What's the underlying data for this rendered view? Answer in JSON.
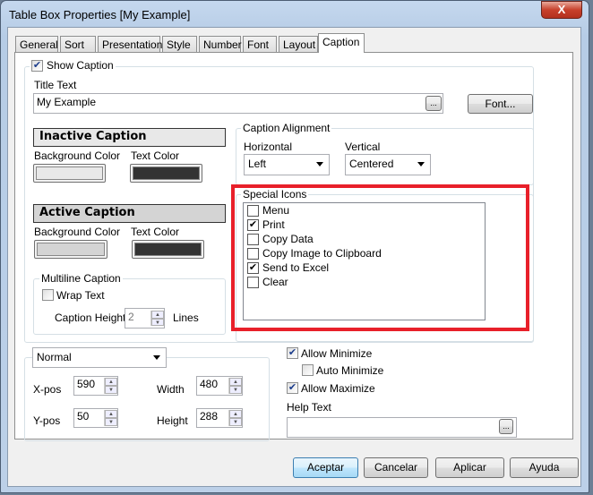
{
  "window": {
    "title": "Table Box Properties [My Example]",
    "close": "X"
  },
  "tabs": [
    "General",
    "Sort",
    "Presentation",
    "Style",
    "Number",
    "Font",
    "Layout",
    "Caption"
  ],
  "caption": {
    "show_caption": {
      "label": "Show Caption",
      "checked": true
    },
    "title_text_label": "Title Text",
    "title_text_value": "My Example",
    "ellipsis": "...",
    "font_button": "Font...",
    "inactive": {
      "header": "Inactive Caption",
      "bg_label": "Background Color",
      "text_label": "Text Color",
      "bg_color": "#e8e8e8",
      "text_color": "#333333"
    },
    "active": {
      "header": "Active Caption",
      "bg_label": "Background Color",
      "text_label": "Text Color",
      "bg_color": "#d4d4d4",
      "text_color": "#333333"
    },
    "multiline": {
      "label": "Multiline Caption",
      "wrap_text": "Wrap Text",
      "wrap_checked": false,
      "height_label": "Caption Height",
      "height_value": "2",
      "lines_label": "Lines"
    },
    "alignment": {
      "label": "Caption Alignment",
      "horizontal_label": "Horizontal",
      "horizontal_value": "Left",
      "vertical_label": "Vertical",
      "vertical_value": "Centered"
    },
    "special_icons": {
      "label": "Special Icons",
      "items": [
        {
          "label": "Menu",
          "checked": false
        },
        {
          "label": "Print",
          "checked": true
        },
        {
          "label": "Copy Data",
          "checked": false
        },
        {
          "label": "Copy Image to Clipboard",
          "checked": false
        },
        {
          "label": "Send to Excel",
          "checked": true
        },
        {
          "label": "Clear",
          "checked": false
        }
      ]
    },
    "highlight_color": "#e8202a"
  },
  "position": {
    "mode": "Normal",
    "xpos_label": "X-pos",
    "xpos": "590",
    "ypos_label": "Y-pos",
    "ypos": "50",
    "width_label": "Width",
    "width": "480",
    "height_label": "Height",
    "height": "288"
  },
  "options": {
    "allow_minimize": "Allow Minimize",
    "auto_minimize": "Auto Minimize",
    "allow_maximize": "Allow Maximize",
    "help_text_label": "Help Text",
    "help_text_value": ""
  },
  "buttons": {
    "ok": "Aceptar",
    "cancel": "Cancelar",
    "apply": "Aplicar",
    "help": "Ayuda"
  }
}
